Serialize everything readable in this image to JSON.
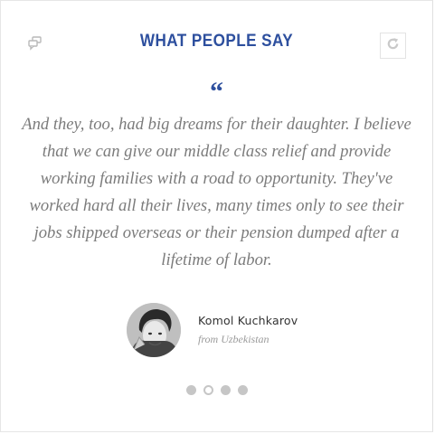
{
  "header": {
    "title": "WHAT PEOPLE SAY",
    "left_icon": "quote-bubbles-icon",
    "refresh_icon": "refresh-icon"
  },
  "testimonial": {
    "quote_mark": "“",
    "text": "And they, too, had big dreams for their daughter. I believe that we can give our middle class relief and provide working families with a road to opportunity. They've worked hard all their lives, many times only to see their jobs shipped overseas or their pension dumped after a lifetime of labor.",
    "author_name": "Komol Kuchkarov",
    "author_from": "from Uzbekistan"
  },
  "pagination": {
    "count": 4,
    "active_index": 1
  },
  "colors": {
    "accent": "#2d4f9e",
    "text_muted": "#7b7b7b",
    "dot": "#c6c6c6"
  }
}
